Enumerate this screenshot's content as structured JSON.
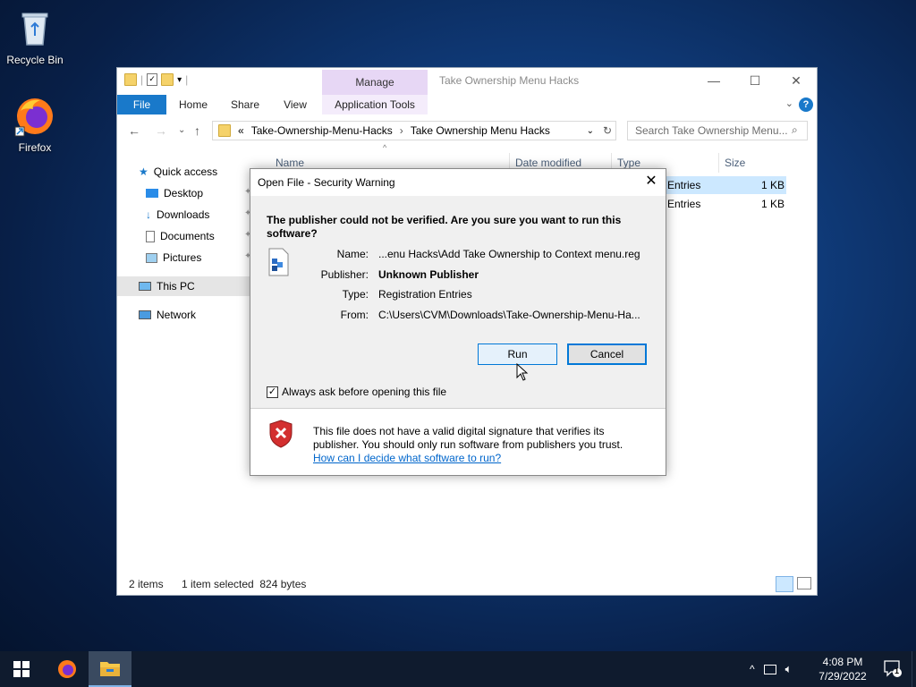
{
  "desktop": {
    "icons": [
      {
        "label": "Recycle Bin"
      },
      {
        "label": "Firefox"
      }
    ]
  },
  "explorer": {
    "title": "Take Ownership Menu Hacks",
    "manage_tab": "Manage",
    "ribbon_tabs": [
      "File",
      "Home",
      "Share",
      "View",
      "Application Tools"
    ],
    "breadcrumb": {
      "prefix": "«",
      "parts": [
        "Take-Ownership-Menu-Hacks",
        "Take Ownership Menu Hacks"
      ]
    },
    "search_placeholder": "Search Take Ownership Menu...",
    "nav": [
      "Quick access",
      "Desktop",
      "Downloads",
      "Documents",
      "Pictures",
      "This PC",
      "Network"
    ],
    "columns": [
      "Name",
      "Date modified",
      "Type",
      "Size"
    ],
    "rows": [
      {
        "type_partial": "n Entries",
        "size": "1 KB"
      },
      {
        "type_partial": "n Entries",
        "size": "1 KB"
      }
    ],
    "status": {
      "items": "2 items",
      "selected": "1 item selected  824 bytes"
    }
  },
  "dialog": {
    "title": "Open File - Security Warning",
    "question": "The publisher could not be verified.  Are you sure you want to run this software?",
    "fields": [
      {
        "label": "Name:",
        "value": "...enu Hacks\\Add Take Ownership to Context menu.reg",
        "bold": false
      },
      {
        "label": "Publisher:",
        "value": "Unknown Publisher",
        "bold": true
      },
      {
        "label": "Type:",
        "value": "Registration Entries",
        "bold": false
      },
      {
        "label": "From:",
        "value": "C:\\Users\\CVM\\Downloads\\Take-Ownership-Menu-Ha...",
        "bold": false
      }
    ],
    "run_label": "Run",
    "cancel_label": "Cancel",
    "checkbox_label": "Always ask before opening this file",
    "checkbox_checked": true,
    "warning_text": "This file does not have a valid digital signature that verifies its publisher.  You should only run software from publishers you trust.",
    "link_text": "How can I decide what software to run?"
  },
  "taskbar": {
    "time": "4:08 PM",
    "date": "7/29/2022",
    "notification_count": "1"
  },
  "colors": {
    "accent": "#1979ca",
    "manage_tab": "#e7d7f5",
    "link": "#0066cc",
    "shield": "#d32f2f"
  }
}
